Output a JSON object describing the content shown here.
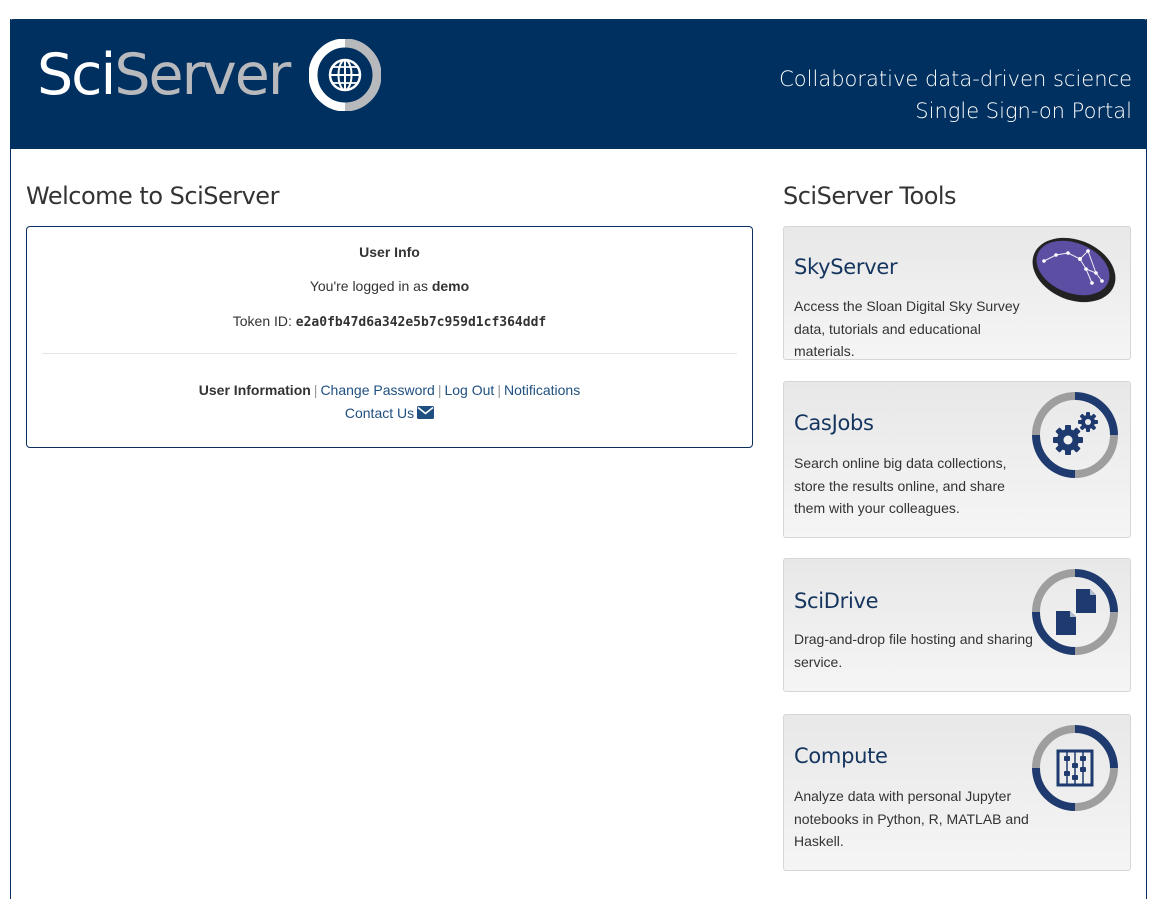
{
  "header": {
    "brand_sci": "Sci",
    "brand_server": "Server",
    "tagline_line1": "Collaborative data-driven science",
    "tagline_line2": "Single Sign-on Portal"
  },
  "welcome": {
    "title": "Welcome to SciServer",
    "panel_heading": "User Info",
    "logged_in_prefix": "You're logged in as ",
    "username": "demo",
    "token_prefix": "Token ID: ",
    "token_id": "e2a0fb47d6a342e5b7c959d1cf364ddf",
    "links": {
      "user_information": "User Information",
      "change_password": "Change Password",
      "log_out": "Log Out",
      "notifications": "Notifications",
      "contact_us": "Contact Us",
      "separator": "|"
    }
  },
  "tools": {
    "title": "SciServer Tools",
    "items": [
      {
        "name": "SkyServer",
        "description": "Access the Sloan Digital Sky Survey data, tutorials and educational materials.",
        "icon": "constellation-icon"
      },
      {
        "name": "CasJobs",
        "description": "Search online big data collections, store the results online, and share them with your colleagues.",
        "icon": "gears-icon"
      },
      {
        "name": "SciDrive",
        "description": "Drag-and-drop file hosting and sharing service.",
        "icon": "files-icon"
      },
      {
        "name": "Compute",
        "description": "Analyze data with personal Jupyter notebooks in Python, R, MATLAB and Haskell.",
        "icon": "abacus-icon"
      }
    ]
  },
  "colors": {
    "header_bg": "#00305f",
    "brand_gray": "#b8b9bd",
    "link": "#1f4f80",
    "tool_title": "#15355f",
    "icon_navy": "#1e3a6e",
    "icon_gray": "#9e9e9e"
  }
}
